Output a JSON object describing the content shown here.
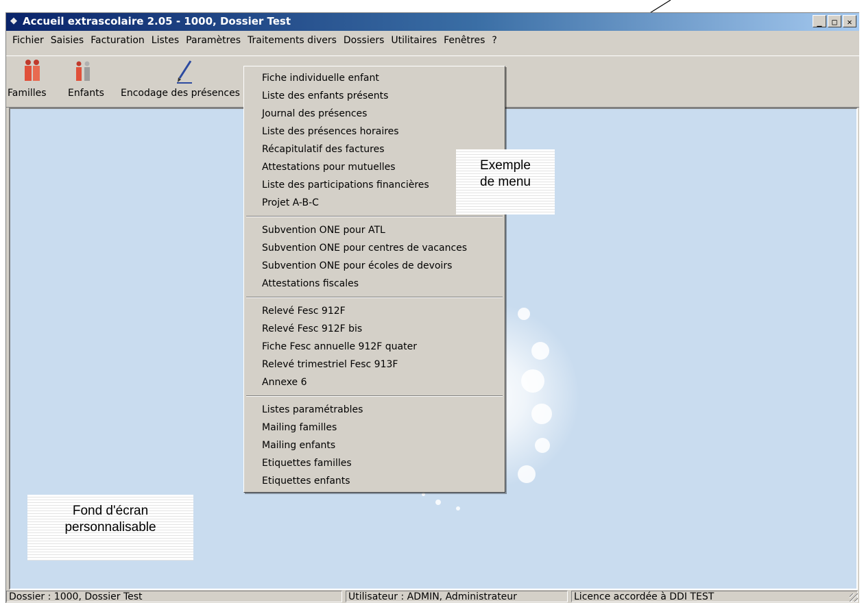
{
  "window": {
    "title": "Accueil extrascolaire 2.05 - 1000, Dossier Test",
    "controls": {
      "minimize": "_",
      "maximize": "□",
      "close": "✕"
    }
  },
  "menubar": {
    "items": [
      "Fichier",
      "Saisies",
      "Facturation",
      "Listes",
      "Paramètres",
      "Traitements divers",
      "Dossiers",
      "Utilitaires",
      "Fenêtres",
      "?"
    ]
  },
  "toolbar": {
    "buttons": [
      {
        "label": "Familles",
        "icon": "family-icon"
      },
      {
        "label": "Enfants",
        "icon": "children-icon"
      },
      {
        "label": "Encodage des présences",
        "icon": "pen-icon"
      }
    ]
  },
  "dropdown": {
    "groups": [
      [
        "Fiche individuelle enfant",
        "Liste des enfants présents",
        "Journal des présences",
        "Liste des présences horaires",
        "Récapitulatif des factures",
        "Attestations pour mutuelles",
        "Liste des participations financières",
        "Projet A-B-C"
      ],
      [
        "Subvention ONE pour ATL",
        "Subvention ONE pour centres de vacances",
        "Subvention ONE pour écoles de devoirs",
        "Attestations fiscales"
      ],
      [
        "Relevé Fesc 912F",
        "Relevé Fesc 912F bis",
        "Fiche Fesc annuelle 912F quater",
        "Relevé trimestriel Fesc 913F",
        "Annexe 6"
      ],
      [
        "Listes paramétrables",
        "Mailing familles",
        "Mailing enfants",
        "Etiquettes familles",
        "Etiquettes enfants"
      ]
    ]
  },
  "callouts": {
    "menu_example": [
      "Exemple",
      "de menu"
    ],
    "wallpaper": [
      "Fond d'écran",
      "personnalisable"
    ]
  },
  "statusbar": {
    "dossier": "Dossier : 1000, Dossier Test",
    "user": "Utilisateur : ADMIN, Administrateur",
    "license": "Licence accordée à DDI TEST"
  },
  "colors": {
    "title_start": "#0a246a",
    "title_end": "#a6caf0",
    "workspace": "#c9dcef",
    "chrome": "#d4d0c8"
  }
}
